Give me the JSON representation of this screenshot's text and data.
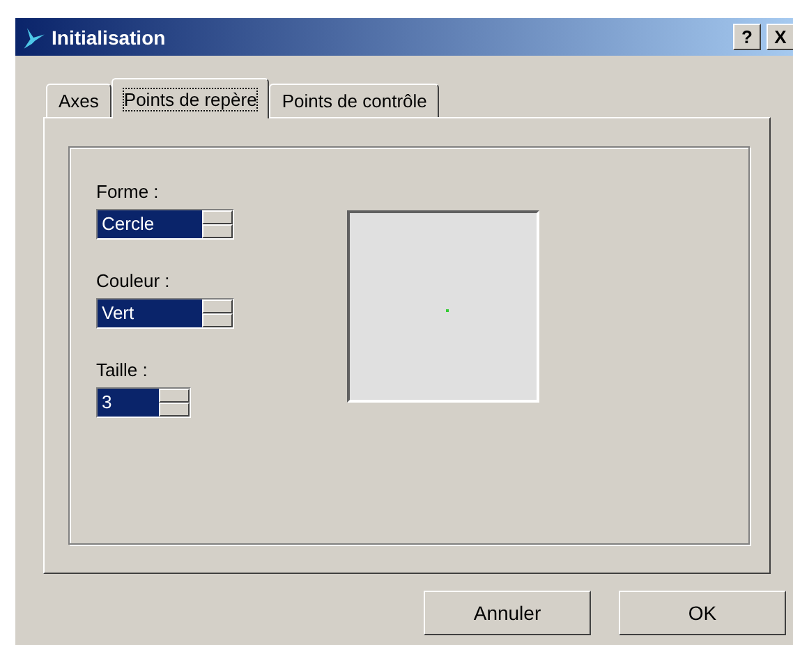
{
  "window": {
    "title": "Initialisation",
    "help_button": "?",
    "close_button": "X"
  },
  "tabs": [
    {
      "label": "Axes",
      "selected": false
    },
    {
      "label": "Points de repère",
      "selected": true
    },
    {
      "label": "Points de contrôle",
      "selected": false
    }
  ],
  "fields": [
    {
      "label": "Forme :",
      "value": "Cercle",
      "kind": "wide"
    },
    {
      "label": "Couleur :",
      "value": "Vert",
      "kind": "wide"
    },
    {
      "label": "Taille :",
      "value": "3",
      "kind": "narrow"
    }
  ],
  "buttons": [
    "Annuler",
    "OK"
  ]
}
